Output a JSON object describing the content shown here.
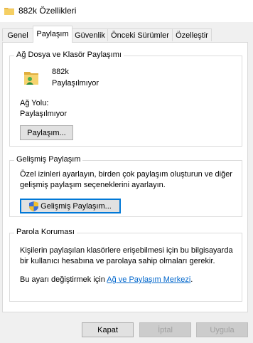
{
  "window": {
    "title": "882k Özellikleri",
    "icon": "folder-icon"
  },
  "tabs": [
    {
      "label": "Genel",
      "active": false
    },
    {
      "label": "Paylaşım",
      "active": true
    },
    {
      "label": "Güvenlik",
      "active": false
    },
    {
      "label": "Önceki Sürümler",
      "active": false
    },
    {
      "label": "Özelleştir",
      "active": false
    }
  ],
  "network_sharing": {
    "title": "Ağ Dosya ve Klasör Paylaşımı",
    "folder_name": "882k",
    "folder_status": "Paylaşılmıyor",
    "path_label": "Ağ Yolu:",
    "path_value": "Paylaşılmıyor",
    "share_button": "Paylaşım..."
  },
  "advanced_sharing": {
    "title": "Gelişmiş Paylaşım",
    "description": "Özel izinleri ayarlayın, birden çok paylaşım oluşturun ve diğer gelişmiş paylaşım seçeneklerini ayarlayın.",
    "button": "Gelişmiş Paylaşım..."
  },
  "password_protection": {
    "title": "Parola Koruması",
    "description": "Kişilerin paylaşılan klasörlere erişebilmesi için bu bilgisayarda bir kullanıcı hesabına ve parolaya sahip olmaları gerekir.",
    "change_prefix": "Bu ayarı değiştirmek için",
    "link": "Ağ ve Paylaşım Merkezi",
    "suffix": "."
  },
  "footer": {
    "ok": "Kapat",
    "cancel": "İptal",
    "apply": "Uygula"
  },
  "colors": {
    "focus_border": "#0078d7",
    "link": "#0066cc",
    "disabled_text": "#a0a0a0"
  }
}
